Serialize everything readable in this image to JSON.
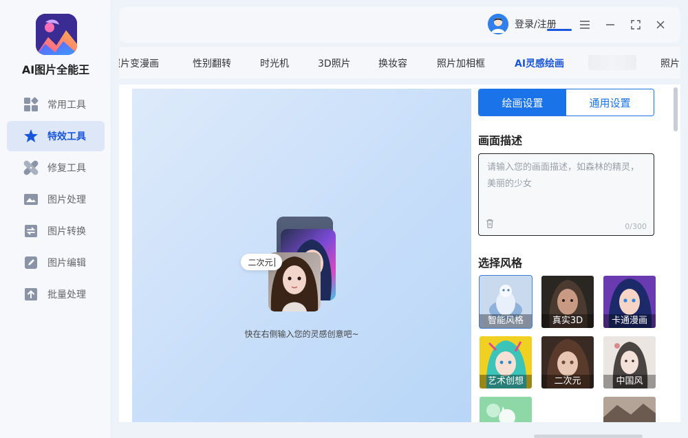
{
  "app": {
    "name": "AI图片全能王"
  },
  "sidebar": {
    "items": [
      {
        "label": "常用工具",
        "icon": "grid-icon",
        "active": false
      },
      {
        "label": "特效工具",
        "icon": "star-icon",
        "active": true
      },
      {
        "label": "修复工具",
        "icon": "bandage-icon",
        "active": false
      },
      {
        "label": "图片处理",
        "icon": "image-icon",
        "active": false
      },
      {
        "label": "图片转换",
        "icon": "convert-icon",
        "active": false
      },
      {
        "label": "图片编辑",
        "icon": "edit-icon",
        "active": false
      },
      {
        "label": "批量处理",
        "icon": "upload-icon",
        "active": false
      }
    ]
  },
  "header": {
    "login_label": "登录/注册"
  },
  "tabs": [
    {
      "label": "照片变漫画"
    },
    {
      "label": "性别翻转"
    },
    {
      "label": "时光机"
    },
    {
      "label": "3D照片"
    },
    {
      "label": "换妆容"
    },
    {
      "label": "照片加相框"
    },
    {
      "label": "AI灵感绘画",
      "active": true
    },
    {
      "label": "照片"
    }
  ],
  "canvas": {
    "tag": "二次元",
    "hint": "快在右侧输入您的灵感创意吧~"
  },
  "settings": {
    "tab_draw": "绘画设置",
    "tab_general": "通用设置",
    "desc_title": "画面描述",
    "desc_placeholder": "请输入您的画面描述，如森林的精灵，美丽的少女",
    "counter": "0/300",
    "style_title": "选择风格",
    "styles": [
      {
        "label": "智能风格",
        "selected": true
      },
      {
        "label": "真实3D"
      },
      {
        "label": "卡通漫画"
      },
      {
        "label": "艺术创想"
      },
      {
        "label": "二次元"
      },
      {
        "label": "中国风"
      },
      {
        "label": ""
      },
      {
        "label": ""
      }
    ]
  },
  "colors": {
    "accent": "#1a73e8",
    "active_nav_bg": "#dde7f7"
  }
}
